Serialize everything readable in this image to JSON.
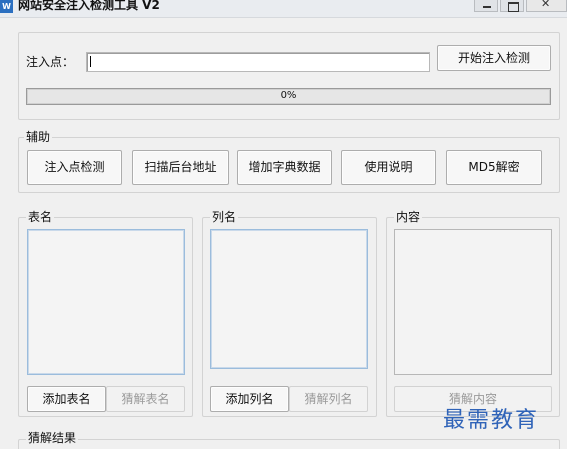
{
  "window": {
    "icon_text": "W",
    "title": "网站安全注入检测工具 V2"
  },
  "injection": {
    "label": "注入点：",
    "url_value": "",
    "start_button": "开始注入检测",
    "progress_text": "0%",
    "progress": 0
  },
  "helper": {
    "legend": "辅助",
    "buttons": [
      "注入点检测",
      "扫描后台地址",
      "增加字典数据",
      "使用说明",
      "MD5解密"
    ]
  },
  "tables": {
    "legend": "表名",
    "add_button": "添加表名",
    "guess_button": "猜解表名"
  },
  "columns": {
    "legend": "列名",
    "add_button": "添加列名",
    "guess_button": "猜解列名"
  },
  "content": {
    "legend": "内容",
    "guess_button": "猜解内容"
  },
  "results": {
    "legend": "猜解结果"
  },
  "watermark": "最需教育"
}
